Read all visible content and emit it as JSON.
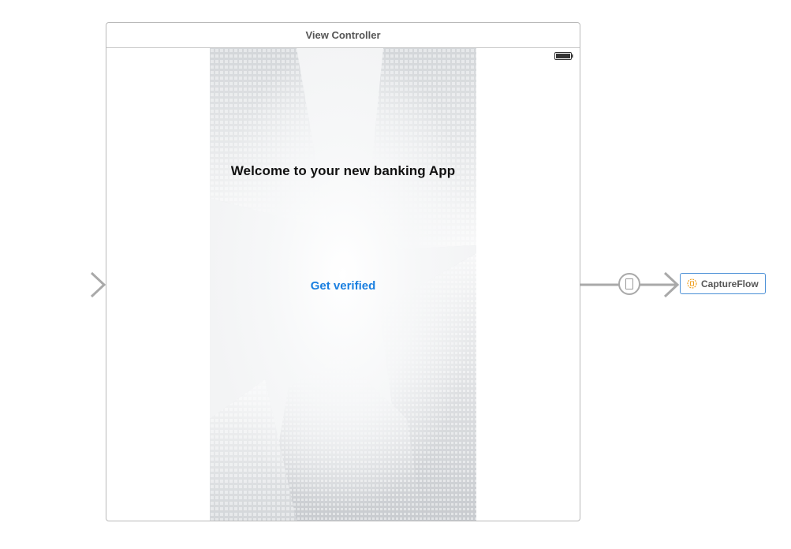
{
  "scene": {
    "title": "View Controller"
  },
  "content": {
    "welcome_text": "Welcome to your new banking App",
    "verify_button_label": "Get verified"
  },
  "storyboard_reference": {
    "label": "CaptureFlow",
    "icon": "storyboard-reference-icon"
  },
  "colors": {
    "button_tint": "#1a7fe0",
    "selection_border": "#4a8fd6",
    "reference_icon": "#f0a020",
    "arrow": "#a9a9a9"
  }
}
